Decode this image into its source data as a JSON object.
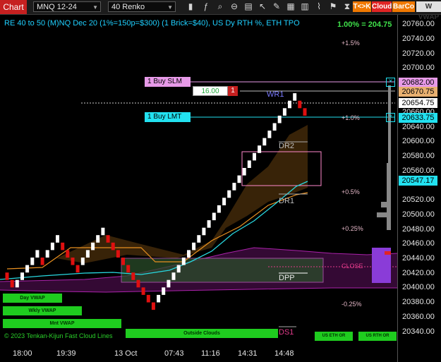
{
  "toolbar": {
    "chart_tab": "Chart",
    "instrument": "MNQ 12-24",
    "bar_type": "40 Renko",
    "tck_label": "T<>K",
    "cloud_label": "Cloud",
    "barco_label": "BarCo",
    "vwap_label": "W VWAP",
    "icons": [
      "bar-chart-icon",
      "indicator-icon",
      "search-icon",
      "zoom-out-icon",
      "template-icon",
      "cursor-icon",
      "pen-icon",
      "properties-icon",
      "chart-style-icon",
      "data-series-icon",
      "strategy-icon",
      "calendar-icon",
      "hourglass-icon"
    ]
  },
  "header": {
    "title": "RE 40 to 50 (M)NQ Dec 20 (1%=150p=$300) (1 Brick=$40), US Dy RTH %, ETH TPO",
    "pct_value": "1.00% = 204.75"
  },
  "y_axis": {
    "ticks": [
      "20760.00",
      "20740.00",
      "20720.00",
      "20700.00",
      "20660.00",
      "20640.00",
      "20600.00",
      "20580.00",
      "20560.00",
      "20520.00",
      "20500.00",
      "20480.00",
      "20460.00",
      "20440.00",
      "20420.00",
      "20400.00",
      "20380.00",
      "20360.00",
      "20340.00"
    ]
  },
  "x_axis": {
    "ticks": [
      "18:00",
      "19:39",
      "13 Oct",
      "07:43",
      "11:16",
      "14:31",
      "14:48"
    ]
  },
  "orders": {
    "buy_slm": "1 Buy SLM",
    "buy_lmt": "1 Buy LMT",
    "qty_value": "16.00",
    "qty_count": "1"
  },
  "price_tags": {
    "p1": "20682.00",
    "p2": "20670.75",
    "p3": "20654.75",
    "p4": "20633.75",
    "p5": "20547.17"
  },
  "chart_labels": {
    "pct_plus15": "+1.5%",
    "pct_plus10": "+1.0%",
    "pct_plus05": "+0.5%",
    "pct_plus025": "+0.25%",
    "pct_minus025": "-0.25%",
    "wr1": "WR1",
    "dr2": "DR2",
    "dr1": "DR1",
    "dpp": "DPP",
    "ds1": "DS1",
    "close": "CLOSE",
    "copyright": "© 2023 Tenkan-Kijun Fast Cloud Lines"
  },
  "buttons": {
    "day_vwap": "Day VWAP",
    "wkly_vwap": "Wkly VWAP",
    "mnt_vwap": "Mnt VWAP",
    "outside_clouds": "Outside Clouds",
    "us_eth_or": "US ETH OR",
    "us_rth_or": "US RTH OR"
  },
  "colors": {
    "accent_red": "#c62020",
    "bull_brick": "#ffffff",
    "bear_brick": "#e01010",
    "title_cyan": "#1fd0ff",
    "green": "#1fcc1f",
    "order_magenta": "#e79ae8",
    "order_cyan": "#22e1f0"
  },
  "chart_data": {
    "type": "renko",
    "ylim": [
      20330,
      20775
    ],
    "brick_size": 10,
    "bricks": [
      [
        20420,
        20430,
        "down"
      ],
      [
        20410,
        20420,
        "down"
      ],
      [
        20410,
        20420,
        "up"
      ],
      [
        20420,
        20430,
        "up"
      ],
      [
        20430,
        20440,
        "up"
      ],
      [
        20440,
        20450,
        "up"
      ],
      [
        20450,
        20460,
        "up"
      ],
      [
        20440,
        20450,
        "down"
      ],
      [
        20450,
        20460,
        "up"
      ],
      [
        20460,
        20470,
        "up"
      ],
      [
        20470,
        20480,
        "up"
      ],
      [
        20460,
        20470,
        "down"
      ],
      [
        20450,
        20460,
        "down"
      ],
      [
        20440,
        20450,
        "down"
      ],
      [
        20430,
        20440,
        "down"
      ],
      [
        20440,
        20450,
        "up"
      ],
      [
        20450,
        20460,
        "up"
      ],
      [
        20460,
        20470,
        "up"
      ],
      [
        20470,
        20480,
        "up"
      ],
      [
        20480,
        20490,
        "up"
      ],
      [
        20470,
        20480,
        "down"
      ],
      [
        20460,
        20470,
        "down"
      ],
      [
        20450,
        20460,
        "down"
      ],
      [
        20440,
        20450,
        "down"
      ],
      [
        20430,
        20440,
        "down"
      ],
      [
        20420,
        20430,
        "down"
      ],
      [
        20410,
        20420,
        "down"
      ],
      [
        20400,
        20410,
        "down"
      ],
      [
        20390,
        20400,
        "down"
      ],
      [
        20380,
        20390,
        "down"
      ],
      [
        20390,
        20400,
        "up"
      ],
      [
        20400,
        20410,
        "up"
      ],
      [
        20410,
        20420,
        "up"
      ],
      [
        20420,
        20430,
        "up"
      ],
      [
        20430,
        20440,
        "up"
      ],
      [
        20440,
        20450,
        "up"
      ],
      [
        20450,
        20460,
        "up"
      ],
      [
        20460,
        20470,
        "up"
      ],
      [
        20470,
        20480,
        "up"
      ],
      [
        20480,
        20490,
        "up"
      ],
      [
        20490,
        20500,
        "up"
      ],
      [
        20500,
        20510,
        "up"
      ],
      [
        20510,
        20520,
        "up"
      ],
      [
        20520,
        20530,
        "up"
      ],
      [
        20530,
        20540,
        "up"
      ],
      [
        20540,
        20550,
        "up"
      ],
      [
        20550,
        20560,
        "up"
      ],
      [
        20560,
        20570,
        "up"
      ],
      [
        20570,
        20580,
        "up"
      ],
      [
        20580,
        20590,
        "up"
      ],
      [
        20590,
        20600,
        "up"
      ],
      [
        20600,
        20610,
        "up"
      ],
      [
        20610,
        20620,
        "up"
      ],
      [
        20620,
        20630,
        "up"
      ],
      [
        20630,
        20640,
        "up"
      ],
      [
        20640,
        20650,
        "up"
      ],
      [
        20650,
        20660,
        "up"
      ],
      [
        20660,
        20670,
        "up"
      ],
      [
        20650,
        20660,
        "down"
      ],
      [
        20640,
        20650,
        "down"
      ]
    ]
  }
}
